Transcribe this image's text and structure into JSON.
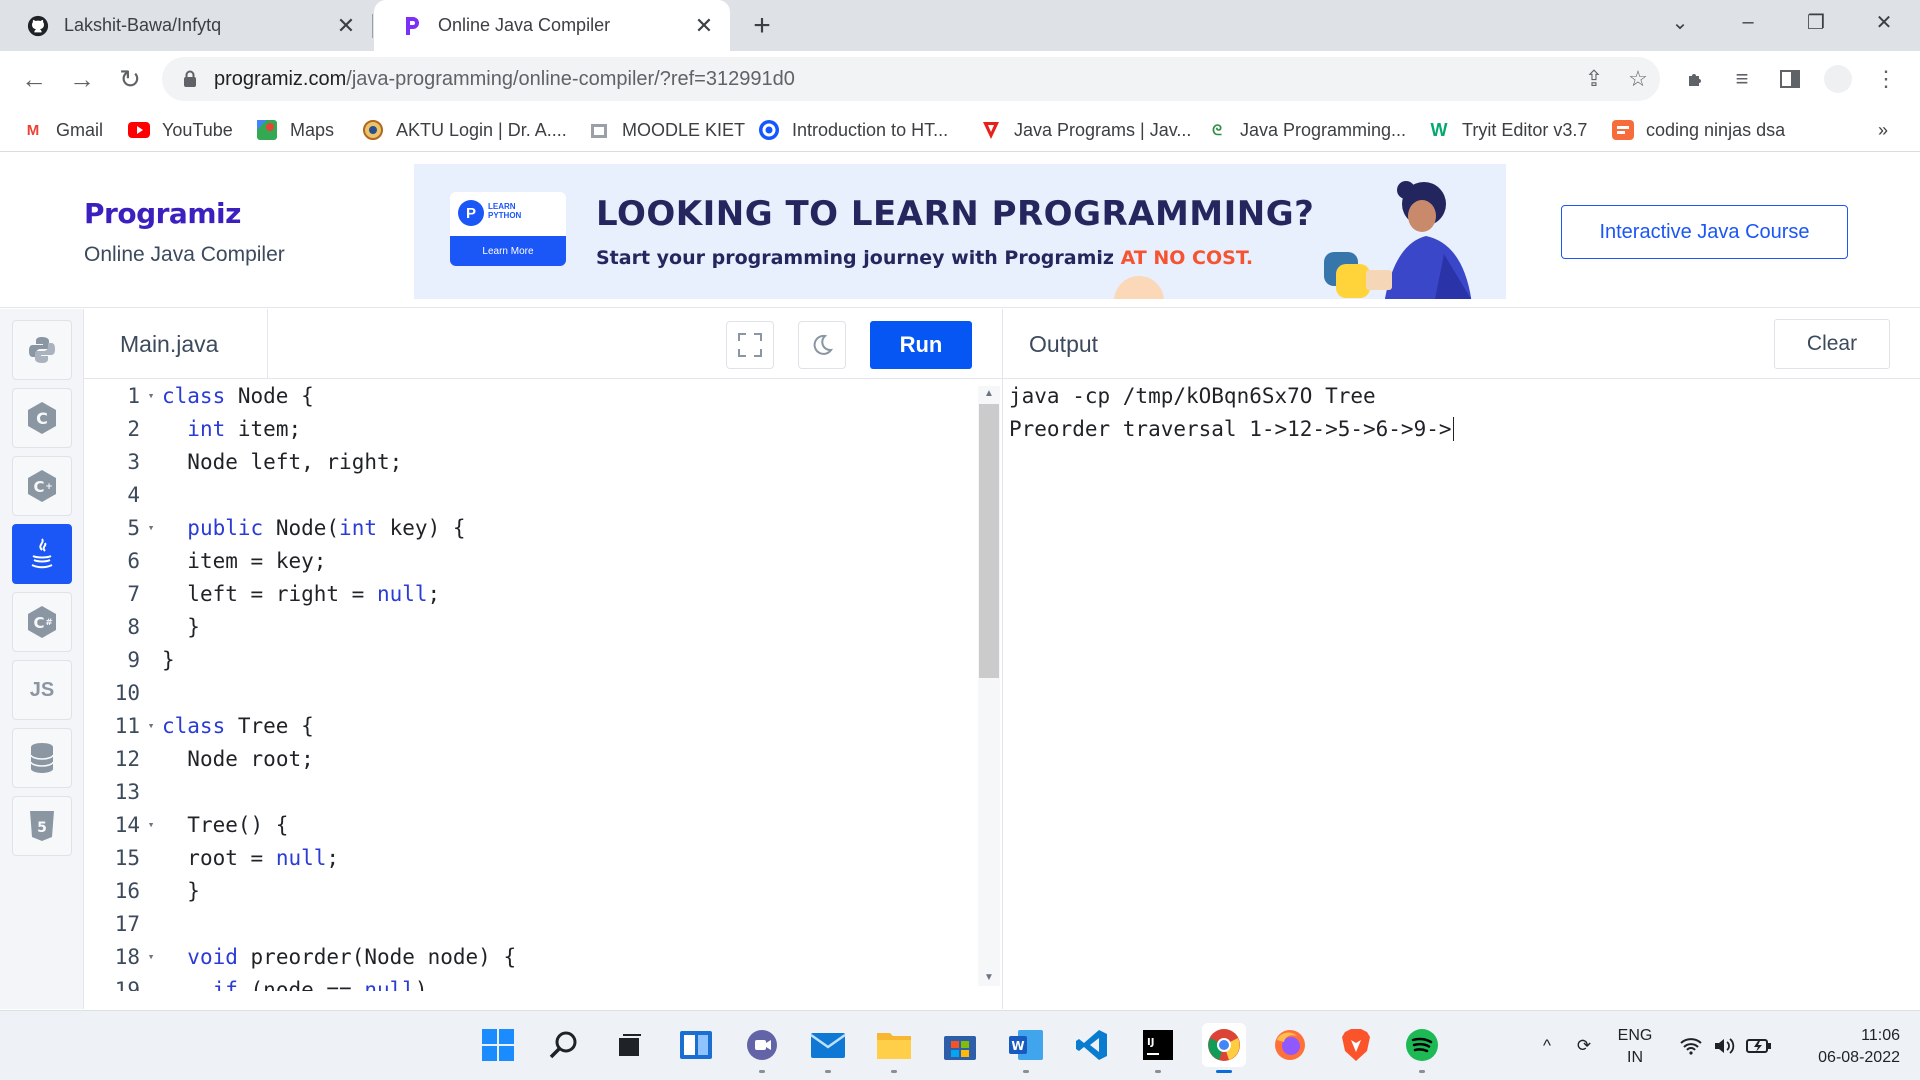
{
  "browser": {
    "tabs": [
      {
        "title": "Lakshit-Bawa/Infytq",
        "active": false,
        "icon": "github-icon"
      },
      {
        "title": "Online Java Compiler",
        "active": true,
        "icon": "programiz-icon"
      }
    ],
    "url_host": "programiz.com",
    "url_path": "/java-programming/online-compiler/?ref=312991d0",
    "bookmarks": [
      {
        "label": "Gmail",
        "icon": "gmail-icon"
      },
      {
        "label": "YouTube",
        "icon": "youtube-icon"
      },
      {
        "label": "Maps",
        "icon": "maps-icon"
      },
      {
        "label": "AKTU Login | Dr. A....",
        "icon": "aktu-icon"
      },
      {
        "label": "MOODLE KIET",
        "icon": "moodle-icon"
      },
      {
        "label": "Introduction to HT...",
        "icon": "codecademy-icon"
      },
      {
        "label": "Java Programs | Jav...",
        "icon": "javatpoint-icon"
      },
      {
        "label": "Java Programming...",
        "icon": "geeks-icon"
      },
      {
        "label": "Tryit Editor v3.7",
        "icon": "w3schools-icon"
      },
      {
        "label": "coding ninjas dsa",
        "icon": "codingninjas-icon"
      }
    ],
    "more_bookmarks": "»"
  },
  "header": {
    "logo": "Programiz",
    "subtitle": "Online Java Compiler",
    "banner": {
      "badge_small": "LEARN PYTHON",
      "badge_button": "Learn More",
      "headline": "LOOKING TO LEARN PROGRAMMING?",
      "tagline_prefix": "Start your programming journey with Programiz ",
      "tagline_highlight": "AT NO COST."
    },
    "course_button": "Interactive Java Course"
  },
  "sidebar": {
    "languages": [
      {
        "name": "python-icon",
        "label": ""
      },
      {
        "name": "c-icon",
        "label": ""
      },
      {
        "name": "cpp-icon",
        "label": ""
      },
      {
        "name": "java-icon",
        "label": "",
        "active": true
      },
      {
        "name": "csharp-icon",
        "label": ""
      },
      {
        "name": "javascript-icon",
        "label": "JS"
      },
      {
        "name": "sql-icon",
        "label": ""
      },
      {
        "name": "html-icon",
        "label": ""
      }
    ]
  },
  "editor": {
    "filename": "Main.java",
    "run_label": "Run",
    "lines": [
      {
        "n": "1",
        "fold": true,
        "code": "class Node {"
      },
      {
        "n": "2",
        "fold": false,
        "code": "  int item;"
      },
      {
        "n": "3",
        "fold": false,
        "code": "  Node left, right;"
      },
      {
        "n": "4",
        "fold": false,
        "code": ""
      },
      {
        "n": "5",
        "fold": true,
        "code": "  public Node(int key) {"
      },
      {
        "n": "6",
        "fold": false,
        "code": "  item = key;"
      },
      {
        "n": "7",
        "fold": false,
        "code": "  left = right = null;"
      },
      {
        "n": "8",
        "fold": false,
        "code": "  }"
      },
      {
        "n": "9",
        "fold": false,
        "code": "}"
      },
      {
        "n": "10",
        "fold": false,
        "code": ""
      },
      {
        "n": "11",
        "fold": true,
        "code": "class Tree {"
      },
      {
        "n": "12",
        "fold": false,
        "code": "  Node root;"
      },
      {
        "n": "13",
        "fold": false,
        "code": ""
      },
      {
        "n": "14",
        "fold": true,
        "code": "  Tree() {"
      },
      {
        "n": "15",
        "fold": false,
        "code": "  root = null;"
      },
      {
        "n": "16",
        "fold": false,
        "code": "  }"
      },
      {
        "n": "17",
        "fold": false,
        "code": ""
      },
      {
        "n": "18",
        "fold": true,
        "code": "  void preorder(Node node) {"
      },
      {
        "n": "19",
        "fold": false,
        "code": "    if (node == null)"
      }
    ]
  },
  "output": {
    "title": "Output",
    "clear_label": "Clear",
    "lines": [
      "java -cp /tmp/kOBqn6Sx7O Tree",
      "Preorder traversal 1->12->5->6->9->"
    ]
  },
  "taskbar": {
    "apps": [
      "windows-start-icon",
      "search-icon",
      "task-view-icon",
      "widgets-icon",
      "teams-chat-icon",
      "mail-icon",
      "file-explorer-icon",
      "microsoft-store-icon",
      "word-icon",
      "vscode-icon",
      "intellij-icon",
      "chrome-icon",
      "firefox-icon",
      "brave-icon",
      "spotify-icon"
    ],
    "lang_top": "ENG",
    "lang_bottom": "IN",
    "time": "11:06",
    "date": "06-08-2022"
  },
  "colors": {
    "accent": "#0556f3",
    "keyword": "#2a3bd6",
    "logo": "#3c1fbf",
    "highlight": "#f65430"
  }
}
